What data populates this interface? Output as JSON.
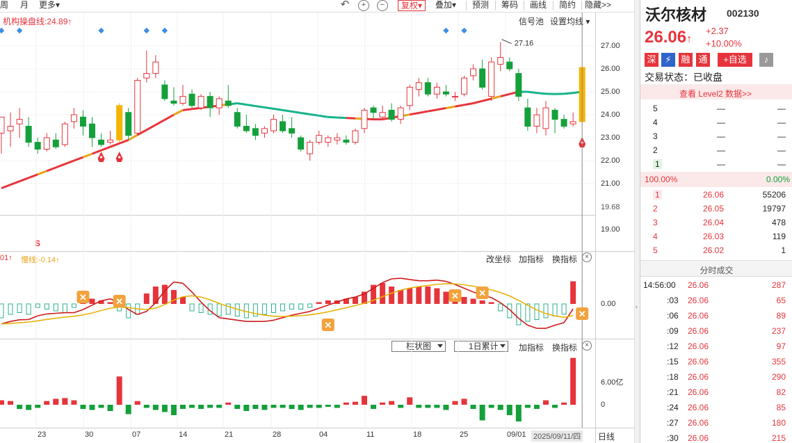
{
  "toolbar": {
    "items": [
      "周",
      "月",
      "更多",
      "复权",
      "叠加",
      "预测",
      "筹码",
      "画线",
      "简约",
      "隐藏>>"
    ]
  },
  "chart": {
    "main_line_label": "机构操盘线:24.89↑",
    "signal_pool": "信号池",
    "set_ma": "设置均线",
    "high_marker": "27.16",
    "price_axis": [
      "27.00",
      "26.00",
      "25.00",
      "24.00",
      "23.00",
      "22.00",
      "21.00",
      "19.68",
      "19.00"
    ],
    "s_marker": "S",
    "indicator_left_label": "01↑",
    "slow_line_label": "慢线:-0.14↑",
    "change_axis": "改坐标",
    "add_indicator": "加指标",
    "switch_indicator": "换指标",
    "macd_zero": "0.00",
    "vol_axis": [
      "6.00亿",
      "0"
    ],
    "vol_mode": "柱状图",
    "vol_period": "1日累计",
    "dates": [
      "23",
      "30",
      "07",
      "14",
      "21",
      "28",
      "04",
      "11",
      "18",
      "25",
      "09/01"
    ],
    "cursor_date": "2025/09/11/四",
    "period": "日线",
    "colors": {
      "up": "#e6343b",
      "down": "#14a03a",
      "signal": "#e8a317"
    }
  },
  "chart_data": {
    "type": "candlestick",
    "candles": [
      {
        "o": 23.2,
        "h": 23.8,
        "l": 22.3,
        "c": 23.9
      },
      {
        "o": 23.3,
        "h": 24.1,
        "l": 22.6,
        "c": 23.5
      },
      {
        "o": 23.6,
        "h": 24.3,
        "l": 23.0,
        "c": 23.8
      },
      {
        "o": 23.5,
        "h": 23.9,
        "l": 22.6,
        "c": 22.8
      },
      {
        "o": 22.8,
        "h": 23.0,
        "l": 22.3,
        "c": 22.5
      },
      {
        "o": 22.5,
        "h": 23.2,
        "l": 22.4,
        "c": 23.0
      },
      {
        "o": 22.9,
        "h": 23.2,
        "l": 22.5,
        "c": 22.6
      },
      {
        "o": 22.7,
        "h": 23.7,
        "l": 22.6,
        "c": 23.6
      },
      {
        "o": 23.7,
        "h": 24.3,
        "l": 23.4,
        "c": 24.0
      },
      {
        "o": 23.9,
        "h": 24.2,
        "l": 23.1,
        "c": 23.5
      },
      {
        "o": 23.6,
        "h": 23.9,
        "l": 22.6,
        "c": 23.0
      },
      {
        "o": 22.9,
        "h": 23.2,
        "l": 22.6,
        "c": 22.7
      },
      {
        "o": 22.8,
        "h": 23.3,
        "l": 22.7,
        "c": 22.9
      },
      {
        "o": 22.9,
        "h": 24.5,
        "l": 22.8,
        "c": 24.4
      },
      {
        "o": 24.1,
        "h": 24.3,
        "l": 22.9,
        "c": 23.1
      },
      {
        "o": 23.2,
        "h": 25.6,
        "l": 23.1,
        "c": 25.5
      },
      {
        "o": 25.6,
        "h": 26.8,
        "l": 25.4,
        "c": 25.8
      },
      {
        "o": 25.8,
        "h": 26.6,
        "l": 25.6,
        "c": 26.3
      },
      {
        "o": 25.3,
        "h": 25.5,
        "l": 24.6,
        "c": 24.7
      },
      {
        "o": 24.6,
        "h": 25.2,
        "l": 24.4,
        "c": 24.5
      },
      {
        "o": 24.5,
        "h": 25.3,
        "l": 24.4,
        "c": 24.8
      },
      {
        "o": 24.9,
        "h": 25.1,
        "l": 24.3,
        "c": 24.4
      },
      {
        "o": 24.3,
        "h": 24.9,
        "l": 24.2,
        "c": 24.8
      },
      {
        "o": 24.8,
        "h": 25.0,
        "l": 23.9,
        "c": 24.3
      },
      {
        "o": 24.3,
        "h": 24.8,
        "l": 24.0,
        "c": 24.7
      },
      {
        "o": 24.6,
        "h": 25.3,
        "l": 24.3,
        "c": 24.4
      },
      {
        "o": 24.1,
        "h": 24.3,
        "l": 23.4,
        "c": 23.5
      },
      {
        "o": 23.5,
        "h": 24.0,
        "l": 23.2,
        "c": 23.3
      },
      {
        "o": 23.4,
        "h": 23.6,
        "l": 22.9,
        "c": 23.1
      },
      {
        "o": 23.2,
        "h": 23.5,
        "l": 23.0,
        "c": 23.4
      },
      {
        "o": 23.3,
        "h": 24.0,
        "l": 23.2,
        "c": 23.8
      },
      {
        "o": 23.7,
        "h": 24.0,
        "l": 23.2,
        "c": 23.3
      },
      {
        "o": 23.4,
        "h": 23.9,
        "l": 23.0,
        "c": 23.2
      },
      {
        "o": 23.0,
        "h": 23.1,
        "l": 22.4,
        "c": 22.5
      },
      {
        "o": 22.3,
        "h": 22.9,
        "l": 22.0,
        "c": 22.8
      },
      {
        "o": 22.8,
        "h": 23.3,
        "l": 22.7,
        "c": 23.1
      },
      {
        "o": 22.8,
        "h": 23.1,
        "l": 22.6,
        "c": 23.0
      },
      {
        "o": 22.9,
        "h": 23.2,
        "l": 22.7,
        "c": 23.0
      },
      {
        "o": 22.9,
        "h": 23.1,
        "l": 22.7,
        "c": 22.8
      },
      {
        "o": 22.8,
        "h": 23.4,
        "l": 22.7,
        "c": 23.3
      },
      {
        "o": 23.4,
        "h": 24.3,
        "l": 23.2,
        "c": 24.2
      },
      {
        "o": 24.3,
        "h": 24.4,
        "l": 23.8,
        "c": 24.1
      },
      {
        "o": 23.9,
        "h": 24.4,
        "l": 23.8,
        "c": 24.1
      },
      {
        "o": 24.2,
        "h": 24.5,
        "l": 23.7,
        "c": 23.8
      },
      {
        "o": 23.8,
        "h": 24.4,
        "l": 23.6,
        "c": 24.3
      },
      {
        "o": 24.4,
        "h": 25.3,
        "l": 24.2,
        "c": 25.2
      },
      {
        "o": 25.1,
        "h": 25.6,
        "l": 24.8,
        "c": 25.4
      },
      {
        "o": 25.4,
        "h": 25.6,
        "l": 24.8,
        "c": 24.9
      },
      {
        "o": 24.9,
        "h": 25.4,
        "l": 24.7,
        "c": 25.2
      },
      {
        "o": 25.0,
        "h": 25.3,
        "l": 24.8,
        "c": 24.9
      },
      {
        "o": 24.8,
        "h": 25.0,
        "l": 24.6,
        "c": 24.8
      },
      {
        "o": 24.9,
        "h": 25.7,
        "l": 24.8,
        "c": 25.6
      },
      {
        "o": 25.7,
        "h": 26.2,
        "l": 25.5,
        "c": 26.0
      },
      {
        "o": 26.0,
        "h": 26.4,
        "l": 25.1,
        "c": 25.2
      },
      {
        "o": 24.8,
        "h": 26.5,
        "l": 24.6,
        "c": 26.3
      },
      {
        "o": 26.2,
        "h": 27.16,
        "l": 25.9,
        "c": 26.5
      },
      {
        "o": 26.3,
        "h": 26.5,
        "l": 25.9,
        "c": 26.0
      },
      {
        "o": 25.8,
        "h": 26.0,
        "l": 24.6,
        "c": 24.8
      },
      {
        "o": 24.3,
        "h": 24.7,
        "l": 23.3,
        "c": 23.5
      },
      {
        "o": 23.5,
        "h": 24.3,
        "l": 23.2,
        "c": 24.0
      },
      {
        "o": 23.4,
        "h": 24.6,
        "l": 23.1,
        "c": 24.3
      },
      {
        "o": 24.2,
        "h": 24.3,
        "l": 23.2,
        "c": 23.8
      },
      {
        "o": 23.8,
        "h": 24.0,
        "l": 23.4,
        "c": 23.5
      },
      {
        "o": 23.6,
        "h": 24.1,
        "l": 23.5,
        "c": 23.7
      },
      {
        "o": 23.7,
        "h": 26.06,
        "l": 23.7,
        "c": 26.06
      }
    ],
    "line_price": 24.89,
    "macd_bars": [
      -0.4,
      -0.3,
      -0.25,
      -0.3,
      -0.1,
      -0.15,
      -0.2,
      -0.25,
      -0.1,
      0.1,
      0.15,
      0.1,
      0.05,
      -0.2,
      -0.4,
      -0.3,
      0.3,
      0.5,
      0.55,
      0.4,
      0.2,
      -0.2,
      -0.25,
      -0.3,
      -0.35,
      -0.3,
      -0.35,
      -0.4,
      -0.35,
      -0.3,
      -0.25,
      -0.2,
      -0.15,
      -0.15,
      -0.1,
      0.05,
      0.1,
      0.1,
      0.15,
      0.2,
      0.35,
      0.55,
      0.6,
      0.5,
      0.4,
      0.45,
      0.5,
      0.5,
      0.45,
      0.35,
      0.25,
      0.2,
      0.15,
      0.1,
      0.05,
      -0.2,
      -0.4,
      -0.6,
      -0.5,
      -0.45,
      -0.4,
      -0.35,
      -0.3,
      0.65
    ],
    "vol_bars": [
      0.6,
      0.5,
      -0.4,
      -0.5,
      -0.3,
      0.5,
      0.8,
      0.9,
      0.6,
      -0.4,
      -0.5,
      -0.3,
      -0.6,
      3.8,
      -0.9,
      0.5,
      -0.3,
      -0.5,
      -0.7,
      -1.0,
      -0.4,
      -0.3,
      -0.4,
      -0.3,
      -0.3,
      0.3,
      -0.4,
      -0.6,
      -0.4,
      -0.5,
      -0.3,
      -0.3,
      -0.4,
      -0.5,
      -0.3,
      -0.3,
      -0.2,
      -0.3,
      0.3,
      0.4,
      1.2,
      -0.4,
      0.3,
      0.5,
      -0.3,
      1.0,
      -0.3,
      -0.3,
      -0.3,
      -0.5,
      0.5,
      0.8,
      -0.4,
      -1.5,
      -0.3,
      -0.5,
      -1.0,
      -1.6,
      -0.3,
      -0.4,
      0.6,
      -0.3,
      0.3,
      6.3
    ]
  },
  "panel": {
    "stock_name": "沃尔核材",
    "stock_code": "002130",
    "price": "26.06",
    "price_arrow": "↑",
    "change": "+2.37",
    "change_pct": "+10.00%",
    "badges": [
      "深",
      "⚡",
      "融",
      "通"
    ],
    "add_watch": "+自选",
    "trade_status_label": "交易状态：已收盘",
    "level2": "查看 Level2 数据>>",
    "sell_levels": [
      {
        "lvl": "5",
        "price": "—",
        "vol": "—"
      },
      {
        "lvl": "4",
        "price": "—",
        "vol": "—"
      },
      {
        "lvl": "3",
        "price": "—",
        "vol": "—"
      },
      {
        "lvl": "2",
        "price": "—",
        "vol": "—"
      },
      {
        "lvl": "1",
        "price": "—",
        "vol": "—"
      }
    ],
    "ratio_left": "100.00%",
    "ratio_right": "0.00%",
    "buy_levels": [
      {
        "lvl": "1",
        "price": "26.06",
        "vol": "55206"
      },
      {
        "lvl": "2",
        "price": "26.05",
        "vol": "19797"
      },
      {
        "lvl": "3",
        "price": "26.04",
        "vol": "478"
      },
      {
        "lvl": "4",
        "price": "26.03",
        "vol": "119"
      },
      {
        "lvl": "5",
        "price": "26.02",
        "vol": "1"
      }
    ],
    "ticks_title": "分时成交",
    "ticks": [
      {
        "time": "14:56:00",
        "price": "26.06",
        "vol": "287"
      },
      {
        "time": ":03",
        "price": "26.06",
        "vol": "65"
      },
      {
        "time": ":06",
        "price": "26.06",
        "vol": "89"
      },
      {
        "time": ":09",
        "price": "26.06",
        "vol": "237"
      },
      {
        "time": ":12",
        "price": "26.06",
        "vol": "97"
      },
      {
        "time": ":15",
        "price": "26.06",
        "vol": "355"
      },
      {
        "time": ":18",
        "price": "26.06",
        "vol": "290"
      },
      {
        "time": ":21",
        "price": "26.06",
        "vol": "82"
      },
      {
        "time": ":24",
        "price": "26.06",
        "vol": "85"
      },
      {
        "time": ":27",
        "price": "26.06",
        "vol": "180"
      },
      {
        "time": ":30",
        "price": "26.06",
        "vol": "215"
      }
    ]
  }
}
